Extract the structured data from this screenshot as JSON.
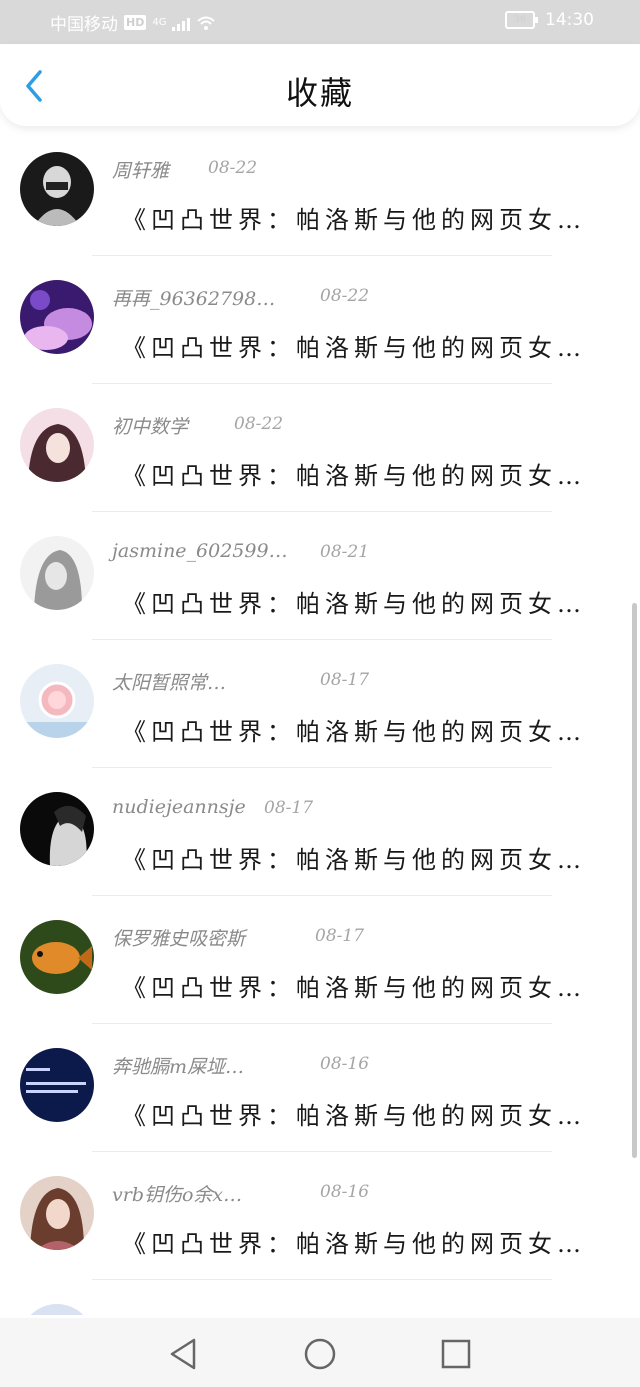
{
  "status_bar": {
    "carrier": "中国移动",
    "hd_label": "HD",
    "network": "4G",
    "battery": "36",
    "time": "14:30"
  },
  "header": {
    "title": "收藏",
    "back_icon": "chevron-left-icon"
  },
  "accent_color": "#2f9de4",
  "items": [
    {
      "user": "周轩雅",
      "date": "08-22",
      "title": "《凹凸世界：帕洛斯与他的网页女…"
    },
    {
      "user": "再再_96362798…",
      "date": "08-22",
      "title": "《凹凸世界：帕洛斯与他的网页女…"
    },
    {
      "user": "初中数学",
      "date": "08-22",
      "title": "《凹凸世界：帕洛斯与他的网页女…"
    },
    {
      "user": "jasmine_602599…",
      "date": "08-21",
      "title": "《凹凸世界：帕洛斯与他的网页女…"
    },
    {
      "user": "太阳暂照常…",
      "date": "08-17",
      "title": "《凹凸世界：帕洛斯与他的网页女…"
    },
    {
      "user": "nudiejeannsje",
      "date": "08-17",
      "title": "《凹凸世界：帕洛斯与他的网页女…"
    },
    {
      "user": "保罗雅史吸密斯",
      "date": "08-17",
      "title": "《凹凸世界：帕洛斯与他的网页女…"
    },
    {
      "user": "奔驰膈m屎垭…",
      "date": "08-16",
      "title": "《凹凸世界：帕洛斯与他的网页女…"
    },
    {
      "user": "vrb钥伤o余x…",
      "date": "08-16",
      "title": "《凹凸世界：帕洛斯与他的网页女…"
    }
  ],
  "nav": {
    "back": "triangle-back-icon",
    "home": "circle-home-icon",
    "recent": "square-recent-icon"
  }
}
